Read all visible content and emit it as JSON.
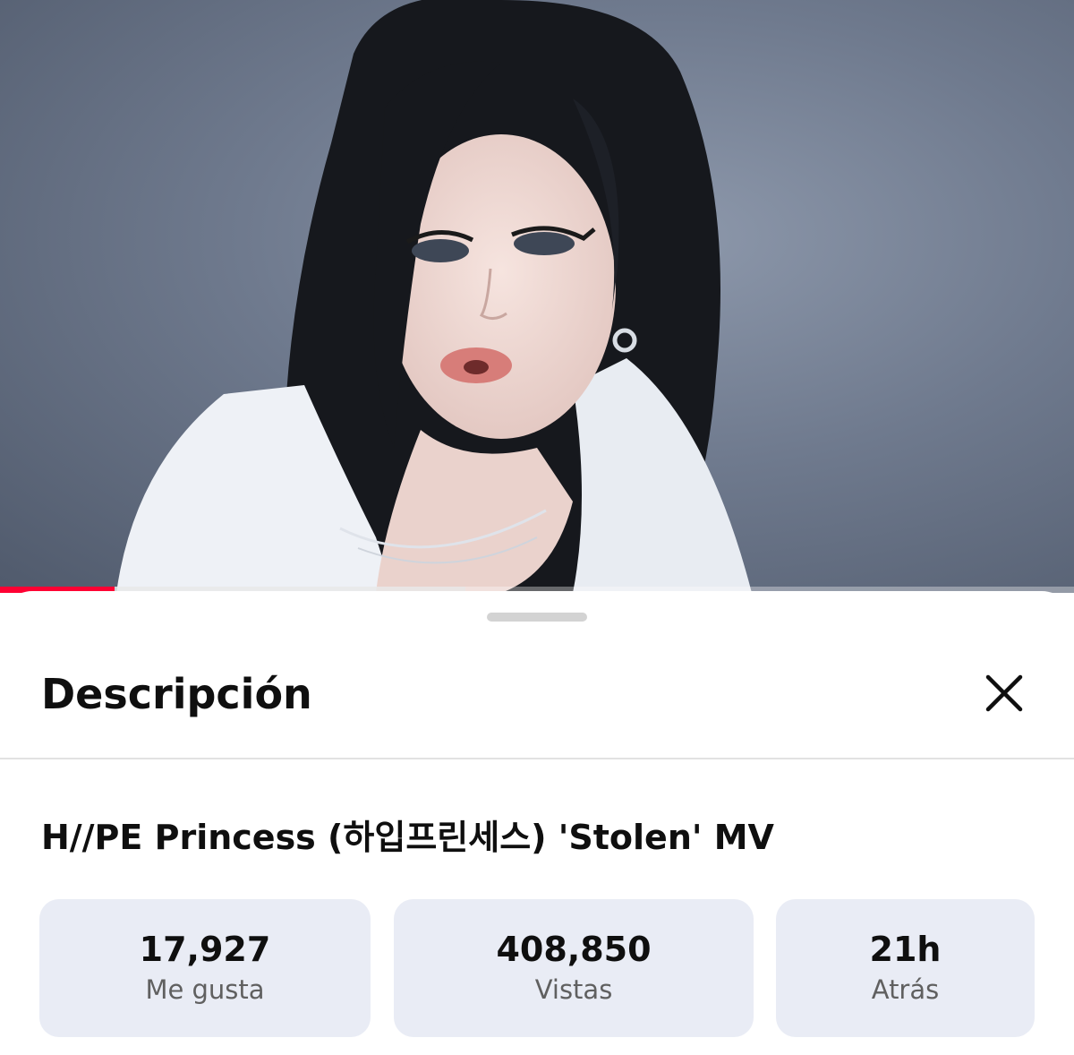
{
  "player": {
    "progress": 0.107,
    "buffered": 0.433,
    "colors": {
      "played": "#ff0033",
      "backdrop": "#6f7a8e"
    }
  },
  "sheet": {
    "title": "Descripción",
    "close_icon": "close-icon"
  },
  "video": {
    "title": "H//PE Princess (하입프린세스) 'Stolen' MV"
  },
  "stats": [
    {
      "value": "17,927",
      "label": "Me gusta"
    },
    {
      "value": "408,850",
      "label": "Vistas"
    },
    {
      "value": "21h",
      "label": "Atrás"
    }
  ]
}
